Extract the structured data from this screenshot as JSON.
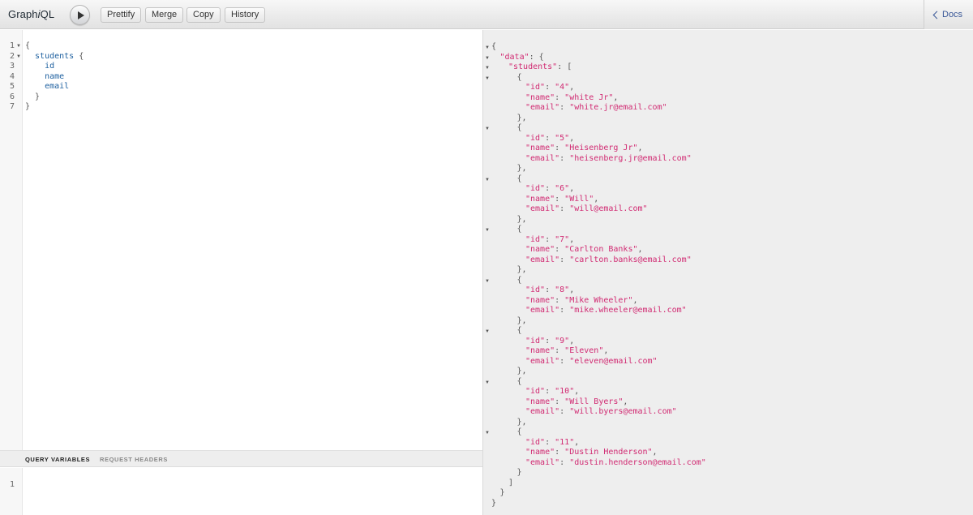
{
  "app": {
    "logo_prefix": "Graph",
    "logo_italic": "i",
    "logo_suffix": "QL"
  },
  "toolbar": {
    "run_icon": "play-icon",
    "prettify_label": "Prettify",
    "merge_label": "Merge",
    "copy_label": "Copy",
    "history_label": "History",
    "docs_label": "Docs",
    "docs_icon": "chevron-left-icon"
  },
  "query_editor": {
    "line_numbers": [
      "1",
      "2",
      "3",
      "4",
      "5",
      "6",
      "7"
    ],
    "lines": [
      {
        "segments": [
          {
            "text": "{",
            "kind": "punct"
          }
        ],
        "fold": true
      },
      {
        "segments": [
          {
            "text": "  students",
            "kind": "field"
          },
          {
            "text": " {",
            "kind": "punct"
          }
        ],
        "fold": true
      },
      {
        "segments": [
          {
            "text": "    id",
            "kind": "field"
          }
        ],
        "fold": false
      },
      {
        "segments": [
          {
            "text": "    name",
            "kind": "field"
          }
        ],
        "fold": false
      },
      {
        "segments": [
          {
            "text": "    email",
            "kind": "field"
          }
        ],
        "fold": false
      },
      {
        "segments": [
          {
            "text": "  }",
            "kind": "punct"
          }
        ],
        "fold": false
      },
      {
        "segments": [
          {
            "text": "}",
            "kind": "punct"
          }
        ],
        "fold": false
      }
    ]
  },
  "variables_panel": {
    "tabs": [
      "QUERY VARIABLES",
      "REQUEST HEADERS"
    ],
    "active_tab": "QUERY VARIABLES",
    "line_numbers": [
      "1"
    ]
  },
  "result": {
    "students": [
      {
        "id": "4",
        "name": "white Jr",
        "email": "white.jr@email.com"
      },
      {
        "id": "5",
        "name": "Heisenberg Jr",
        "email": "heisenberg.jr@email.com"
      },
      {
        "id": "6",
        "name": "Will",
        "email": "will@email.com"
      },
      {
        "id": "7",
        "name": "Carlton Banks",
        "email": "carlton.banks@email.com"
      },
      {
        "id": "8",
        "name": "Mike Wheeler",
        "email": "mike.wheeler@email.com"
      },
      {
        "id": "9",
        "name": "Eleven",
        "email": "eleven@email.com"
      },
      {
        "id": "10",
        "name": "Will Byers",
        "email": "will.byers@email.com"
      },
      {
        "id": "11",
        "name": "Dustin Henderson",
        "email": "dustin.henderson@email.com"
      }
    ]
  }
}
